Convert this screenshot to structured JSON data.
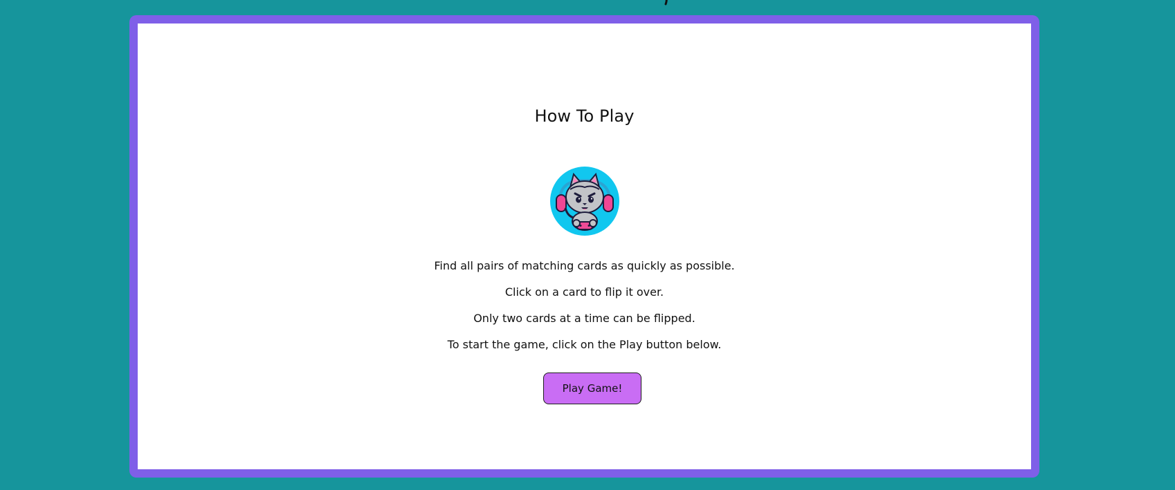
{
  "page": {
    "background_color": "#16959c",
    "panel_border_color": "#7f5fe8"
  },
  "instructions": {
    "title": "How To Play",
    "rules": [
      "Find all pairs of matching cards as quickly as possible.",
      "Click on a card to flip it over.",
      "Only two cards at a time can be flipped.",
      "To start the game, click on the Play button below."
    ],
    "button_label": "Play Game!",
    "button_color": "#c96df4"
  },
  "avatar": {
    "icon": "gamer-cat-icon"
  }
}
